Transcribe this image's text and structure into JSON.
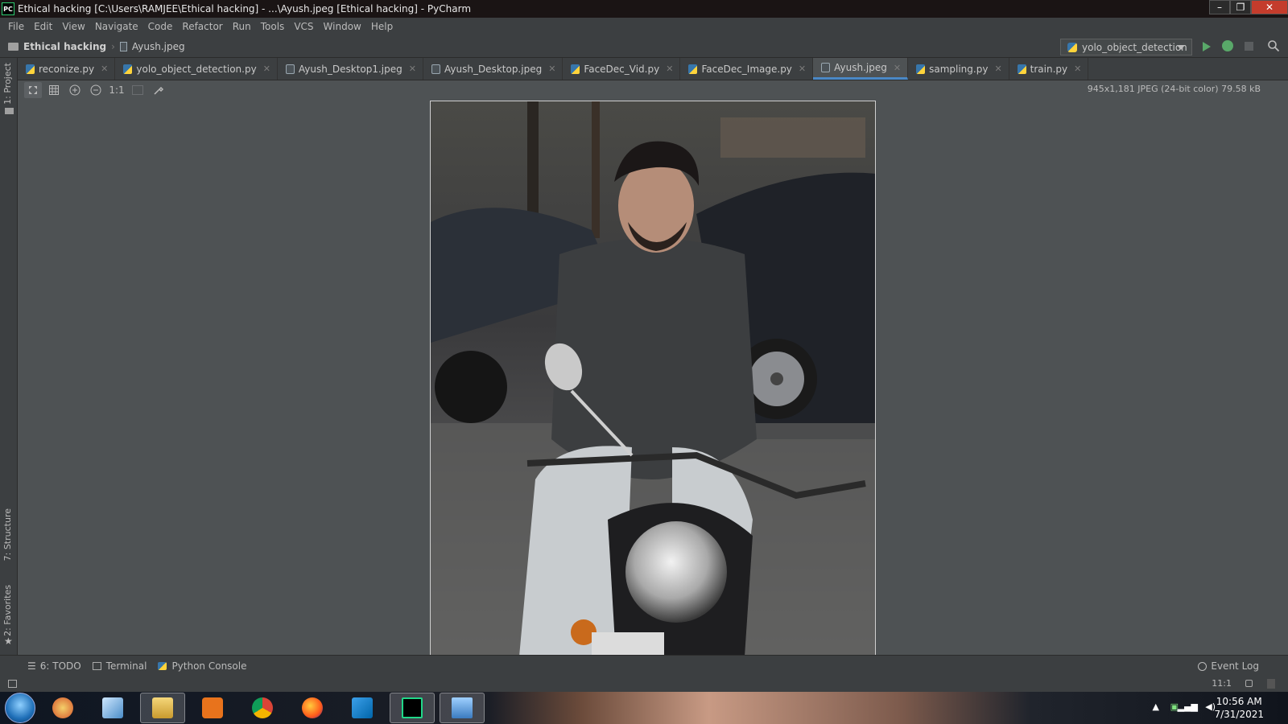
{
  "window": {
    "title": "Ethical hacking [C:\\Users\\RAMJEE\\Ethical hacking] - ...\\Ayush.jpeg [Ethical hacking] - PyCharm",
    "app_icon_label": "PC",
    "minimize": "–",
    "restore": "❐",
    "close": "✕"
  },
  "menu": [
    "File",
    "Edit",
    "View",
    "Navigate",
    "Code",
    "Refactor",
    "Run",
    "Tools",
    "VCS",
    "Window",
    "Help"
  ],
  "breadcrumb": {
    "project": "Ethical hacking",
    "file": "Ayush.jpeg"
  },
  "run_config": {
    "name": "yolo_object_detection"
  },
  "tabs": [
    {
      "label": "reconize.py",
      "type": "py"
    },
    {
      "label": "yolo_object_detection.py",
      "type": "py"
    },
    {
      "label": "Ayush_Desktop1.jpeg",
      "type": "img"
    },
    {
      "label": "Ayush_Desktop.jpeg",
      "type": "img"
    },
    {
      "label": "FaceDec_Vid.py",
      "type": "py"
    },
    {
      "label": "FaceDec_Image.py",
      "type": "py"
    },
    {
      "label": "Ayush.jpeg",
      "type": "img",
      "active": true
    },
    {
      "label": "sampling.py",
      "type": "py"
    },
    {
      "label": "train.py",
      "type": "py"
    }
  ],
  "left_strip": {
    "project": "1: Project",
    "structure": "7: Structure",
    "favorites": "2: Favorites"
  },
  "image_toolbar": {
    "actual_size": "1:1"
  },
  "image_info": "945x1,181 JPEG (24-bit color) 79.58 kB",
  "bottom_tools": {
    "todo": "6: TODO",
    "terminal": "Terminal",
    "python_console": "Python Console",
    "event_log": "Event Log"
  },
  "status": {
    "caret": "11:1"
  },
  "taskbar": {
    "time": "10:56 AM",
    "date": "7/31/2021"
  },
  "colors": {
    "accent": "#4a88c7",
    "editor_bg": "#4e5254",
    "panel_bg": "#3c3f41",
    "run_green": "#59a869"
  }
}
